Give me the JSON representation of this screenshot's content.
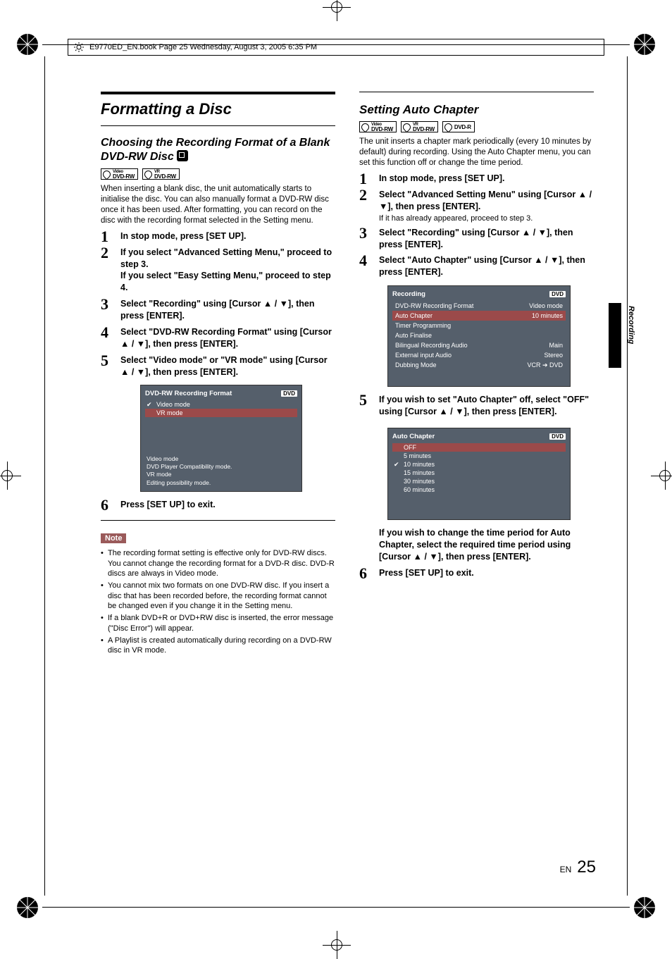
{
  "header": {
    "file_info": "E9770ED_EN.book  Page 25  Wednesday, August 3, 2005  6:35 PM"
  },
  "side_label": "Recording",
  "page": {
    "lang": "EN",
    "num": "25"
  },
  "left": {
    "title": "Formatting a Disc",
    "sub": "Choosing the Recording Format of a Blank DVD-RW Disc",
    "badges": [
      {
        "top": "Video",
        "bot": "DVD-RW"
      },
      {
        "top": "VR",
        "bot": "DVD-RW"
      }
    ],
    "intro": "When inserting a blank disc, the unit automatically starts to initialise the disc. You can also manually format a DVD-RW disc once it has been used. After formatting, you can record on the disc with the recording format selected in the Setting menu.",
    "steps": {
      "s1": "In stop mode, press [SET UP].",
      "s2": "If you select \"Advanced Setting Menu,\" proceed to step 3.\nIf you select \"Easy Setting Menu,\" proceed to step 4.",
      "s3": "Select \"Recording\" using [Cursor ▲ / ▼], then press [ENTER].",
      "s4": "Select \"DVD-RW Recording Format\" using [Cursor ▲ / ▼], then press [ENTER].",
      "s5": "Select \"Video mode\" or \"VR mode\" using [Cursor ▲ / ▼], then press [ENTER].",
      "s6": "Press [SET UP] to exit."
    },
    "osd1": {
      "title": "DVD-RW Recording Format",
      "tag": "DVD",
      "opts": [
        "Video mode",
        "VR mode"
      ],
      "checked": 0,
      "highlight": 1,
      "desc": "Video mode\n  DVD Player Compatibility mode.\nVR mode\n  Editing possibility mode."
    },
    "note_label": "Note",
    "notes": [
      "The recording format setting is effective only for DVD-RW discs. You cannot change the recording format for a DVD-R disc. DVD-R discs are always in Video mode.",
      "You cannot mix two formats on one DVD-RW disc. If you insert a disc that has been recorded before, the recording format cannot be changed even if you change it in the Setting menu.",
      "If a blank DVD+R or DVD+RW disc is inserted, the error message (\"Disc Error\") will appear.",
      "A Playlist is created automatically during recording on a DVD-RW disc in VR mode."
    ]
  },
  "right": {
    "sub": "Setting Auto Chapter",
    "badges": [
      {
        "top": "Video",
        "bot": "DVD-RW"
      },
      {
        "top": "VR",
        "bot": "DVD-RW"
      },
      {
        "top": "",
        "bot": "DVD-R"
      }
    ],
    "intro": "The unit inserts a chapter mark periodically (every 10 minutes by default) during recording. Using the Auto Chapter menu, you can set this function off or change the time period.",
    "steps": {
      "s1": "In stop mode, press [SET UP].",
      "s2": "Select \"Advanced Setting Menu\" using [Cursor ▲ / ▼], then press [ENTER].",
      "s2sub": "If it has already appeared, proceed to step 3.",
      "s3": "Select \"Recording\" using [Cursor ▲ / ▼], then press [ENTER].",
      "s4": "Select \"Auto Chapter\" using [Cursor ▲ / ▼], then press [ENTER].",
      "s5": "If you wish to set \"Auto Chapter\" off, select \"OFF\" using [Cursor ▲ / ▼], then press [ENTER].",
      "s5b": "If you wish to change the time period for Auto Chapter, select the required time period using [Cursor ▲ / ▼], then press [ENTER].",
      "s6": "Press [SET UP] to exit."
    },
    "osd_rec": {
      "title": "Recording",
      "tag": "DVD",
      "rows": [
        {
          "l": "DVD-RW Recording Format",
          "r": "Video mode"
        },
        {
          "l": "Auto Chapter",
          "r": "10 minutes"
        },
        {
          "l": "Timer Programming",
          "r": ""
        },
        {
          "l": "Auto Finalise",
          "r": ""
        },
        {
          "l": "Bilingual Recording Audio",
          "r": "Main"
        },
        {
          "l": "External input Audio",
          "r": "Stereo"
        },
        {
          "l": "Dubbing Mode",
          "r": "VCR ➔ DVD"
        }
      ],
      "highlight": 1
    },
    "osd_ac": {
      "title": "Auto Chapter",
      "tag": "DVD",
      "opts": [
        "OFF",
        "5 minutes",
        "10 minutes",
        "15 minutes",
        "30 minutes",
        "60 minutes"
      ],
      "checked": 2,
      "highlight": 0
    }
  }
}
